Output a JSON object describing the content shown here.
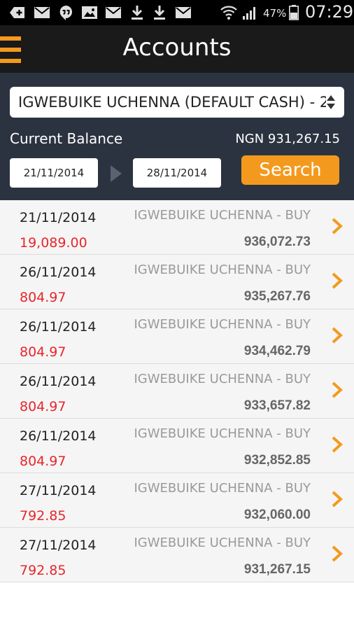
{
  "status_bar": {
    "battery_percent": "47%",
    "time": "07:29",
    "icons": [
      "add-icon",
      "mail-icon",
      "hangouts-icon",
      "image-icon",
      "mail-icon",
      "download-icon",
      "download-icon",
      "mail-icon",
      "wifi-icon",
      "signal-icon",
      "battery-icon"
    ]
  },
  "header": {
    "title": "Accounts",
    "menu_icon": "hamburger-menu-icon"
  },
  "filter": {
    "account_selected": "IGWEBUIKE UCHENNA (DEFAULT CASH) - 2...",
    "balance_label": "Current Balance",
    "balance_value": "NGN 931,267.15",
    "date_from": "21/11/2014",
    "date_to": "28/11/2014",
    "search_label": "Search"
  },
  "transactions": [
    {
      "date": "21/11/2014",
      "description": "IGWEBUIKE UCHENNA - BUY",
      "amount": "19,089.00",
      "balance": "936,072.73"
    },
    {
      "date": "26/11/2014",
      "description": "IGWEBUIKE UCHENNA - BUY",
      "amount": "804.97",
      "balance": "935,267.76"
    },
    {
      "date": "26/11/2014",
      "description": "IGWEBUIKE UCHENNA - BUY",
      "amount": "804.97",
      "balance": "934,462.79"
    },
    {
      "date": "26/11/2014",
      "description": "IGWEBUIKE UCHENNA - BUY",
      "amount": "804.97",
      "balance": "933,657.82"
    },
    {
      "date": "26/11/2014",
      "description": "IGWEBUIKE UCHENNA - BUY",
      "amount": "804.97",
      "balance": "932,852.85"
    },
    {
      "date": "27/11/2014",
      "description": "IGWEBUIKE UCHENNA - BUY",
      "amount": "792.85",
      "balance": "932,060.00"
    },
    {
      "date": "27/11/2014",
      "description": "IGWEBUIKE UCHENNA - BUY",
      "amount": "792.85",
      "balance": "931,267.15"
    }
  ],
  "colors": {
    "accent": "#f39a1e",
    "header_bg": "#1a1a1a",
    "panel_bg": "#2c3340",
    "amount_red": "#e8262a"
  }
}
